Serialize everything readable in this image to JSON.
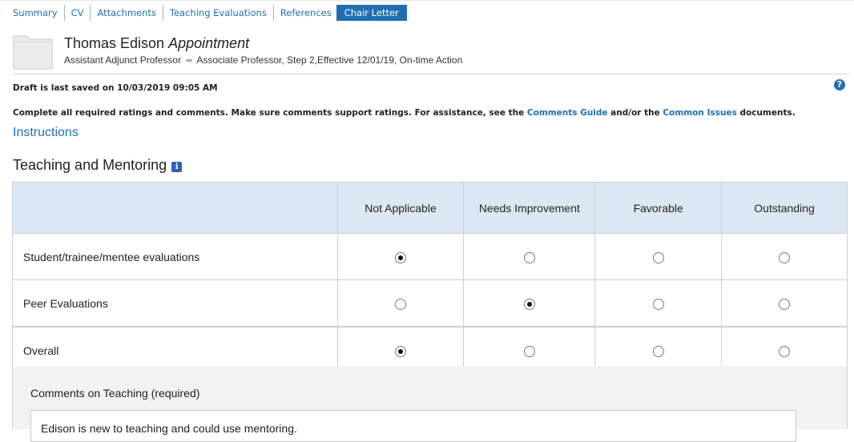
{
  "tabs": [
    {
      "label": "Summary",
      "active": false
    },
    {
      "label": "CV",
      "active": false
    },
    {
      "label": "Attachments",
      "active": false
    },
    {
      "label": "Teaching Evaluations",
      "active": false
    },
    {
      "label": "References",
      "active": false
    },
    {
      "label": "Chair Letter",
      "active": true
    }
  ],
  "header": {
    "name": "Thomas Edison",
    "action_type": "Appointment",
    "from_title": "Assistant Adjunct Professor",
    "to_details": "Associate Professor, Step 2,Effective 12/01/19, On-time Action",
    "arrow_icon": "right-arrow-icon",
    "folder_icon": "folder-icon"
  },
  "status": {
    "saved_text": "Draft is last saved on 10/03/2019 09:05 AM",
    "help_glyph": "?"
  },
  "instructions": {
    "text_before": "Complete all required ratings and comments. Make sure comments support ratings. For assistance, see the ",
    "link1": "Comments Guide",
    "text_middle": " and/or the ",
    "link2": "Common Issues",
    "text_after": " documents.",
    "instructions_link": "Instructions"
  },
  "section": {
    "title": "Teaching and Mentoring",
    "info_glyph": "i"
  },
  "ratings": {
    "columns": [
      "Not Applicable",
      "Needs Improvement",
      "Favorable",
      "Outstanding"
    ],
    "rows": [
      {
        "label": "Student/trainee/mentee evaluations",
        "selected": 0
      },
      {
        "label": "Peer Evaluations",
        "selected": 1
      },
      {
        "label": "Overall",
        "selected": 0
      }
    ]
  },
  "comments": {
    "label": "Comments on Teaching (required)",
    "value": "Edison is new to teaching and could use mentoring."
  },
  "colors": {
    "accent": "#1f6fb0",
    "header_bg": "#dbe8f4",
    "panel_bg": "#f2f2f2"
  }
}
